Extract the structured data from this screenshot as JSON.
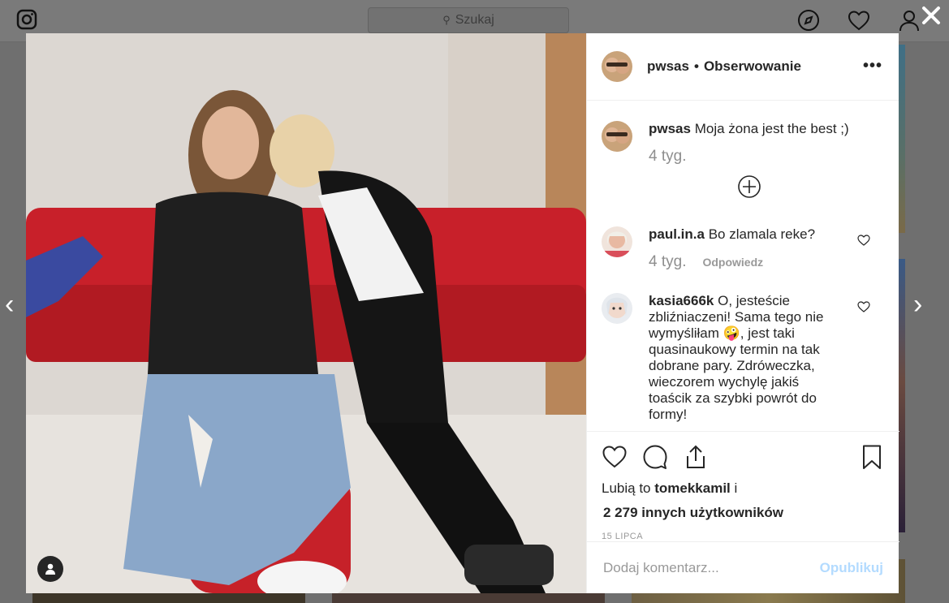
{
  "topbar": {
    "search_placeholder": "Szukaj",
    "icons": [
      "instagram-icon",
      "compass-icon",
      "heart-icon",
      "profile-icon"
    ]
  },
  "post": {
    "author": "pwsas",
    "separator": "•",
    "follow_status": "Obserwowanie",
    "caption": {
      "user": "pwsas",
      "text": "Moja żona jest the best ;)",
      "time": "4 tyg."
    },
    "comments": [
      {
        "user": "paul.in.a",
        "text": "Bo zlamala reke?",
        "time": "4 tyg.",
        "reply_label": "Odpowiedz"
      },
      {
        "user": "kasia666k",
        "text": "O, jesteście zbliźniaczeni! Sama tego nie wymyśliłam 🤪, jest taki quasinaukowy termin na tak dobrane pary. Zdróweczka, wieczorem wychylę jakiś toaścik za szybki powrót do formy!"
      }
    ],
    "likes_prefix": "Lubią to",
    "likes_user": "tomekkamil",
    "likes_joiner": "i",
    "likes_others": "2 279 innych użytkowników",
    "date": "15 LIPCA",
    "comment_placeholder": "Dodaj komentarz...",
    "publish_label": "Opublikuj"
  },
  "colors": {
    "overlay": "#6f6f6f",
    "publish_disabled": "#b3dbff",
    "muted_text": "#8e8e8e"
  }
}
